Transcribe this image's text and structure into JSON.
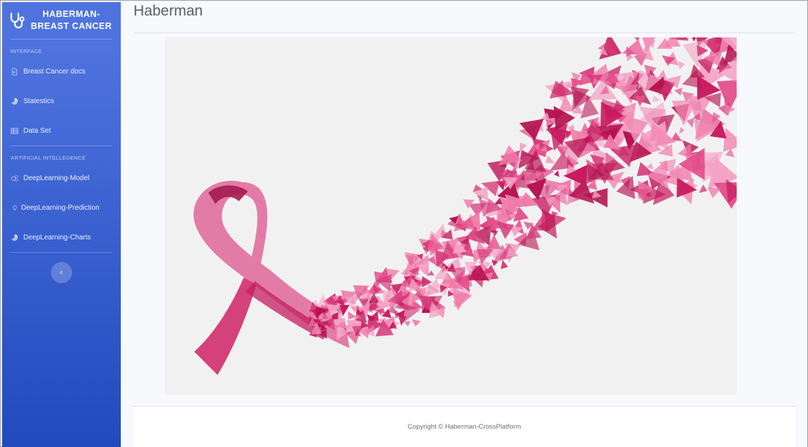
{
  "brand": {
    "line1": "HABERMAN-",
    "line2": "BREAST CANCER",
    "icon": "stethoscope-icon"
  },
  "sidebar": {
    "sections": [
      {
        "heading": "INTERFACE",
        "items": [
          {
            "label": "Breast Cancer docs",
            "icon": "file-icon"
          },
          {
            "label": "Statestics",
            "icon": "pie-chart-icon"
          },
          {
            "label": "Data Set",
            "icon": "table-icon"
          }
        ]
      },
      {
        "heading": "ARTIFICIAL INTELLEGENCE",
        "items": [
          {
            "label": "DeepLearning-Model",
            "icon": "cogs-icon"
          },
          {
            "label": "DeepLearning-Prediction",
            "icon": "lightbulb-icon"
          },
          {
            "label": "DeepLearning-Charts",
            "icon": "pie-chart-icon"
          }
        ]
      }
    ],
    "toggle_glyph": "‹"
  },
  "main": {
    "title": "Haberman",
    "hero_image": "pink-ribbon-illustration"
  },
  "footer": {
    "copyright": "Copyright © Haberman-CrossPlatform"
  },
  "colors": {
    "sidebar_top": "#4e73df",
    "sidebar_bottom": "#224abe",
    "ribbon": "#d6336c",
    "background": "#f8f9fc"
  }
}
